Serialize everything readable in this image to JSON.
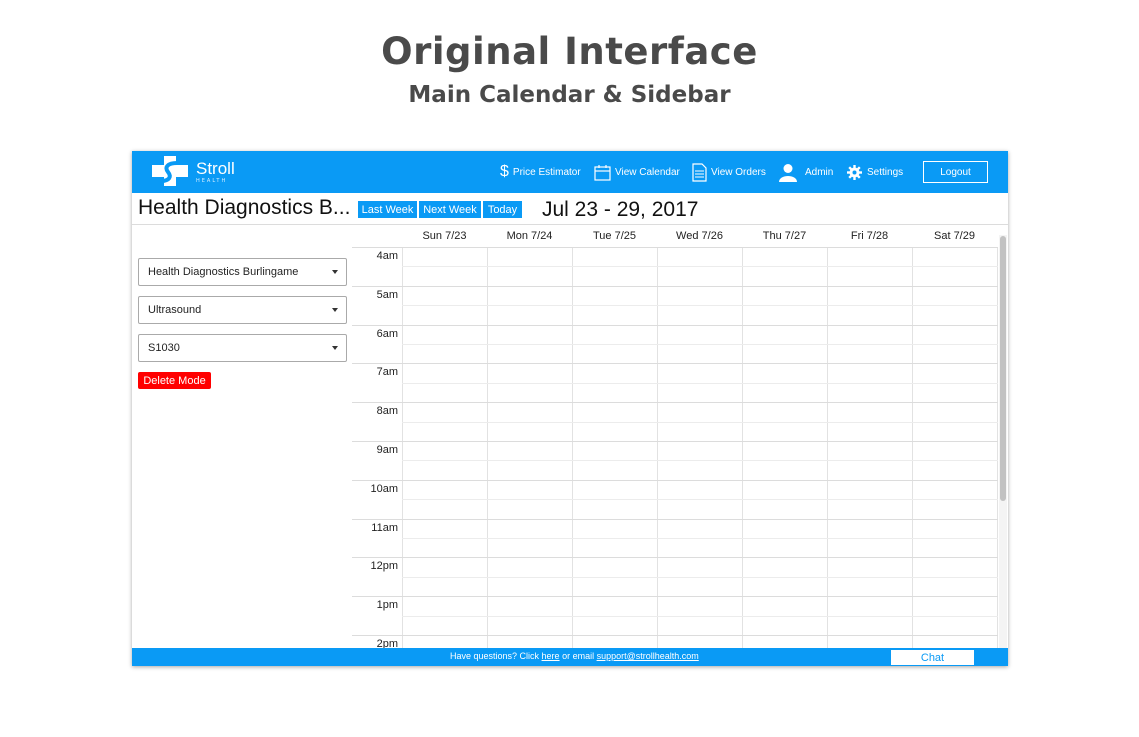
{
  "heading": {
    "title": "Original Interface",
    "subtitle": "Main Calendar & Sidebar"
  },
  "header": {
    "logo_name": "Stroll",
    "logo_sub": "HEALTH",
    "nav": [
      {
        "label": "Price Estimator",
        "icon": "dollar-icon"
      },
      {
        "label": "View Calendar",
        "icon": "calendar-icon"
      },
      {
        "label": "View Orders",
        "icon": "document-icon"
      },
      {
        "label": "Admin",
        "icon": "user-icon"
      },
      {
        "label": "Settings",
        "icon": "gear-icon"
      }
    ],
    "logout_label": "Logout"
  },
  "toolbar": {
    "title": "Health Diagnostics B...",
    "last_week": "Last Week",
    "next_week": "Next Week",
    "today": "Today",
    "date_range": "Jul 23 - 29, 2017"
  },
  "sidebar": {
    "facility": "Health Diagnostics Burlingame",
    "modality": "Ultrasound",
    "resource": "S1030",
    "delete_mode": "Delete Mode"
  },
  "calendar": {
    "days": [
      "Sun 7/23",
      "Mon 7/24",
      "Tue 7/25",
      "Wed 7/26",
      "Thu 7/27",
      "Fri 7/28",
      "Sat 7/29"
    ],
    "times": [
      "4am",
      "5am",
      "6am",
      "7am",
      "8am",
      "9am",
      "10am",
      "11am",
      "12pm",
      "1pm",
      "2pm"
    ]
  },
  "footer": {
    "prefix": "Have questions? Click ",
    "here": "here",
    "middle": " or email ",
    "email": "support@strollhealth.com",
    "chat": "Chat"
  },
  "colors": {
    "brand": "#0a9af5",
    "danger": "#ff0000"
  }
}
